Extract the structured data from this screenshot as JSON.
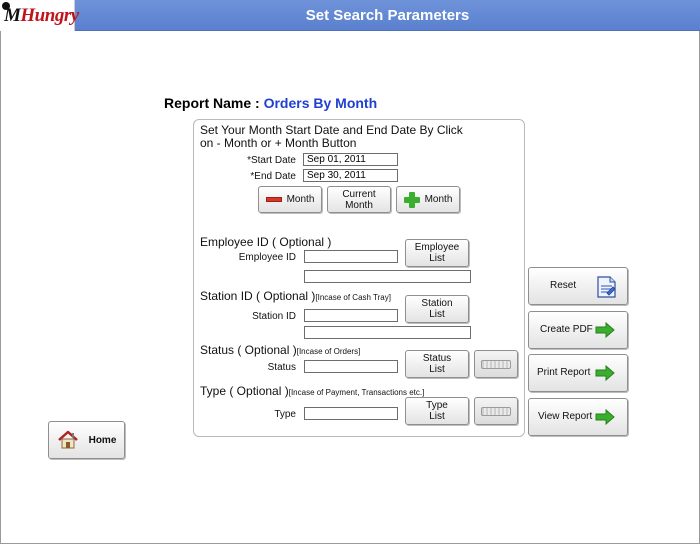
{
  "header": {
    "logo_text_m": "M",
    "logo_text_rest": "Hungry",
    "title": "Set Search Parameters"
  },
  "report": {
    "label": "Report Name :",
    "value": "Orders By Month"
  },
  "instructions": {
    "line1": "Set Your Month Start Date and End Date By Click",
    "line2": "on - Month or + Month Button"
  },
  "dates": {
    "start_label": "*Start Date",
    "start_value": "Sep 01, 2011",
    "end_label": "*End Date",
    "end_value": "Sep 30, 2011"
  },
  "month_buttons": {
    "minus": "Month",
    "current": "Current\nMonth",
    "plus": "Month"
  },
  "employee": {
    "section": "Employee ID ( Optional )",
    "label": "Employee ID",
    "value": "",
    "name_value": "",
    "list_button": "Employee\nList"
  },
  "station": {
    "section": "Station ID ( Optional )",
    "note": "[Incase of Cash Tray]",
    "label": "Station ID",
    "value": "",
    "name_value": "",
    "list_button": "Station\nList"
  },
  "status": {
    "section": "Status ( Optional )",
    "note": "[Incase of Orders]",
    "label": "Status",
    "value": "",
    "list_button": "Status\nList"
  },
  "type": {
    "section": "Type ( Optional )",
    "note": "[Incase of Payment, Transactions etc.]",
    "label": "Type",
    "value": "",
    "list_button": "Type\nList"
  },
  "side_buttons": {
    "reset": "Reset",
    "create_pdf": "Create PDF",
    "print_report": "Print Report",
    "view_report": "View Report"
  },
  "home": {
    "label": "Home"
  },
  "icons": {
    "arrow": "green-right-arrow-icon",
    "minus": "red-minus-icon",
    "plus": "green-plus-icon",
    "keyboard": "keyboard-icon",
    "document": "document-icon",
    "home": "house-icon"
  },
  "colors": {
    "header_bg": "#5a80cf",
    "report_value": "#1f3fd1",
    "logo_red": "#c0141b",
    "arrow_green": "#3cae2f"
  }
}
